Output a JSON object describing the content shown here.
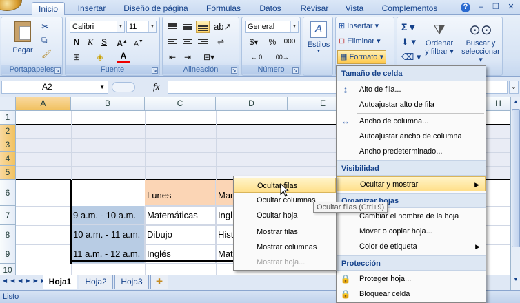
{
  "ribbon_tabs": [
    "Inicio",
    "Insertar",
    "Diseño de página",
    "Fórmulas",
    "Datos",
    "Revisar",
    "Vista",
    "Complementos"
  ],
  "groups": {
    "clipboard": {
      "label": "Portapapeles",
      "paste": "Pegar"
    },
    "font": {
      "label": "Fuente",
      "font_name": "Calibri",
      "font_size": "11"
    },
    "alignment": {
      "label": "Alineación"
    },
    "number": {
      "label": "Número",
      "format": "General",
      "percent": "%",
      "thousands": "000"
    },
    "styles": {
      "label": "Estilos"
    },
    "cells": {
      "insert": "Insertar",
      "delete": "Eliminar",
      "format": "Formato"
    },
    "editing": {
      "sort_filter": "Ordenar\ny filtrar",
      "sort_filter_l1": "Ordenar",
      "sort_filter_l2": "y filtrar",
      "find_l1": "Buscar y",
      "find_l2": "seleccionar"
    }
  },
  "formula_bar": {
    "name_box": "A2",
    "fx": "fx",
    "value": ""
  },
  "columns": [
    "A",
    "B",
    "C",
    "D",
    "E",
    "H"
  ],
  "rows": [
    "1",
    "2",
    "3",
    "4",
    "5",
    "6",
    "7",
    "8",
    "9",
    "10"
  ],
  "cells": {
    "c6": "Lunes",
    "d6": "Mar",
    "b7": "9 a.m. - 10 a.m.",
    "c7": "Matemáticas",
    "d7": "Ingl",
    "b8": "10 a.m. - 11 a.m.",
    "c8": "Dibujo",
    "d8": "Hist",
    "b9": "11 a.m. - 12 a.m.",
    "c9": "Inglés",
    "d9": "Mat"
  },
  "sheets": [
    "Hoja1",
    "Hoja2",
    "Hoja3"
  ],
  "status": "Listo",
  "format_menu": {
    "h_size": "Tamaño de celda",
    "row_height": "Alto de fila...",
    "autofit_row": "Autoajustar alto de fila",
    "col_width": "Ancho de columna...",
    "autofit_col": "Autoajustar ancho de columna",
    "default_width": "Ancho predeterminado...",
    "h_visibility": "Visibilidad",
    "hide_show": "Ocultar y mostrar",
    "h_organize": "Organizar hojas",
    "rename": "Cambiar el nombre de la hoja",
    "move_copy": "Mover o copiar hoja...",
    "tab_color": "Color de etiqueta",
    "h_protection": "Protección",
    "protect": "Proteger hoja...",
    "lock": "Bloquear celda"
  },
  "hide_submenu": {
    "hide_rows": "Ocultar filas",
    "hide_cols": "Ocultar columnas",
    "hide_sheet": "Ocultar hoja",
    "show_rows": "Mostrar filas",
    "show_cols": "Mostrar columnas",
    "show_sheet": "Mostrar hoja..."
  },
  "tooltip": "Ocultar filas (Ctrl+9)",
  "colors": {
    "header_fill": "#fbd5b5",
    "time_fill": "#b8cce4",
    "blank_fill": "#e9ecf5",
    "accent": "#15428b"
  }
}
